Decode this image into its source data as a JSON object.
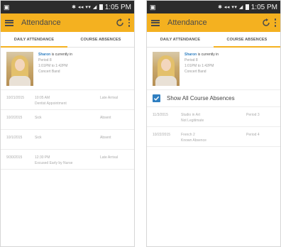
{
  "status_bar": {
    "time": "1:05 PM"
  },
  "app": {
    "title": "Attendance"
  },
  "tabs": [
    {
      "label": "DAILY ATTENDANCE"
    },
    {
      "label": "COURSE ABSENCES"
    }
  ],
  "student": {
    "name": "Sharon",
    "status_text": "is currently in",
    "period": "Period 8",
    "time_range": "1:01PM to 1:42PM",
    "course": "Concert Band"
  },
  "daily_records": [
    {
      "date": "10/21/2015",
      "time": "10:05 AM",
      "note": "Dentist Appointment",
      "status": "Late Arrival"
    },
    {
      "date": "10/2/2015",
      "time": "",
      "note": "Sick",
      "status": "Absent"
    },
    {
      "date": "10/1/2015",
      "time": "",
      "note": "Sick",
      "status": "Absent"
    },
    {
      "date": "9/30/2015",
      "time": "12:30 PM",
      "note": "Excused Early by Nurse",
      "status": "Late Arrival"
    }
  ],
  "course_absences": {
    "show_all_label": "Show All Course Absences",
    "records": [
      {
        "date": "11/3/2015",
        "course": "Studio in Art",
        "note": "Not Legitimate",
        "period": "Period 3"
      },
      {
        "date": "10/22/2015",
        "course": "French 2",
        "note": "Known Absence",
        "period": "Period 4"
      }
    ]
  },
  "colors": {
    "appbar": "#f4b120",
    "accent": "#2f7fc1",
    "statusbar": "#2b2b2b"
  }
}
